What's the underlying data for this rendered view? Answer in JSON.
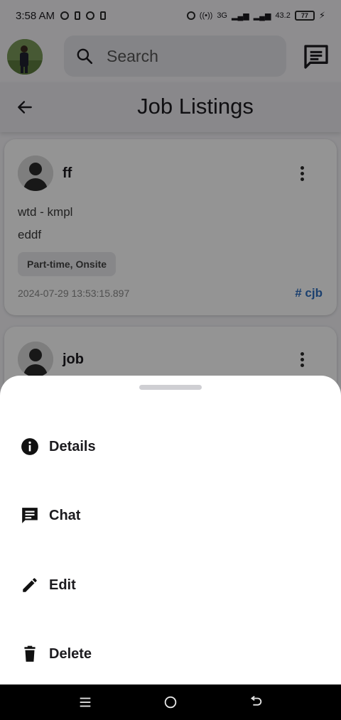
{
  "status_bar": {
    "time": "3:58 AM",
    "network_label": "3G",
    "speed": "43.2",
    "battery_level": "77"
  },
  "top_bar": {
    "search_placeholder": "Search"
  },
  "title_bar": {
    "title": "Job Listings"
  },
  "listings": [
    {
      "name": "ff",
      "line1": "wtd - kmpl",
      "line2": "eddf",
      "chip": "Part-time, Onsite",
      "timestamp": "2024-07-29 13:53:15.897",
      "tag": "# cjb"
    },
    {
      "name": "job"
    }
  ],
  "sheet": {
    "items": [
      {
        "label": "Details",
        "icon": "info-icon"
      },
      {
        "label": "Chat",
        "icon": "chat-icon"
      },
      {
        "label": "Edit",
        "icon": "pencil-icon"
      },
      {
        "label": "Delete",
        "icon": "trash-icon"
      }
    ]
  },
  "colors": {
    "accent_tag": "#2f6fbf",
    "scrim": "rgba(0,0,0,0.42)",
    "sheet_background": "#ffffff"
  }
}
